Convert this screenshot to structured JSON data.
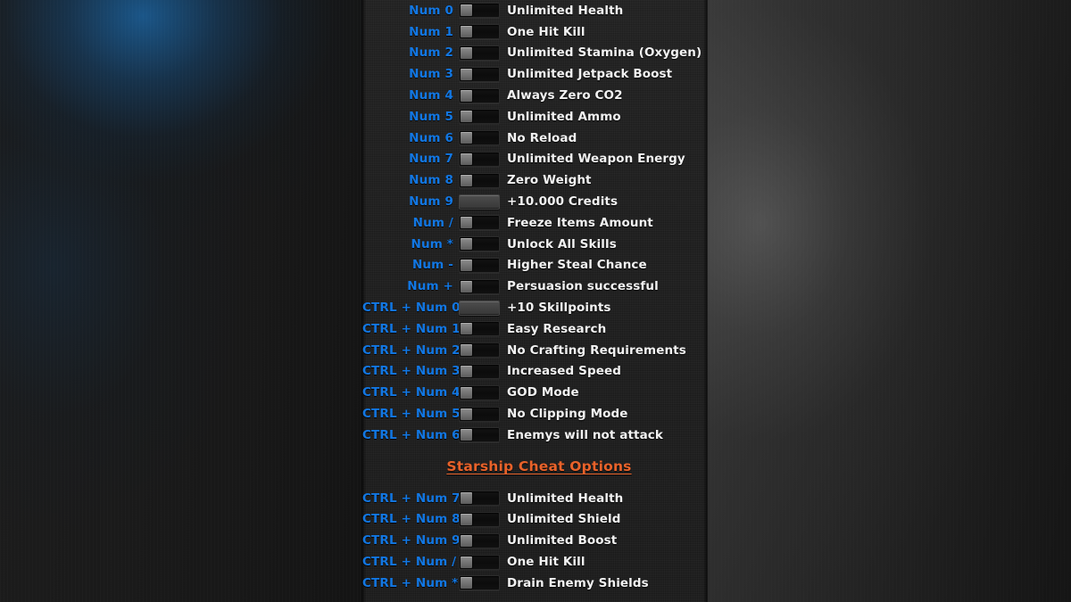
{
  "panel": {
    "accent_hotkey_color": "#1277e3",
    "accent_label_color": "#f2f2f2",
    "accent_section_color": "#e8622a",
    "panel_bg_color": "#1b1b1b",
    "toggle_state": "off"
  },
  "sections": [
    {
      "title": null,
      "rows": [
        {
          "hotkey": "Num 0",
          "control": "toggle",
          "label": "Unlimited Health"
        },
        {
          "hotkey": "Num 1",
          "control": "toggle",
          "label": "One Hit Kill"
        },
        {
          "hotkey": "Num 2",
          "control": "toggle",
          "label": "Unlimited Stamina (Oxygen)"
        },
        {
          "hotkey": "Num 3",
          "control": "toggle",
          "label": "Unlimited Jetpack Boost"
        },
        {
          "hotkey": "Num 4",
          "control": "toggle",
          "label": "Always Zero CO2"
        },
        {
          "hotkey": "Num 5",
          "control": "toggle",
          "label": "Unlimited Ammo"
        },
        {
          "hotkey": "Num 6",
          "control": "toggle",
          "label": "No Reload"
        },
        {
          "hotkey": "Num 7",
          "control": "toggle",
          "label": "Unlimited Weapon Energy"
        },
        {
          "hotkey": "Num 8",
          "control": "toggle",
          "label": "Zero Weight"
        },
        {
          "hotkey": "Num 9",
          "control": "button",
          "label": "+10.000 Credits"
        },
        {
          "hotkey": "Num /",
          "control": "toggle",
          "label": "Freeze Items Amount"
        },
        {
          "hotkey": "Num *",
          "control": "toggle",
          "label": "Unlock All Skills"
        },
        {
          "hotkey": "Num -",
          "control": "toggle",
          "label": "Higher Steal Chance"
        },
        {
          "hotkey": "Num +",
          "control": "toggle",
          "label": "Persuasion successful"
        },
        {
          "hotkey": "CTRL + Num 0",
          "control": "button",
          "label": "+10 Skillpoints"
        },
        {
          "hotkey": "CTRL + Num 1",
          "control": "toggle",
          "label": "Easy Research"
        },
        {
          "hotkey": "CTRL + Num 2",
          "control": "toggle",
          "label": "No Crafting Requirements"
        },
        {
          "hotkey": "CTRL + Num 3",
          "control": "toggle",
          "label": "Increased Speed"
        },
        {
          "hotkey": "CTRL + Num 4",
          "control": "toggle",
          "label": "GOD Mode"
        },
        {
          "hotkey": "CTRL + Num 5",
          "control": "toggle",
          "label": "No Clipping Mode"
        },
        {
          "hotkey": "CTRL + Num 6",
          "control": "toggle",
          "label": "Enemys will not attack"
        }
      ]
    },
    {
      "title": "Starship Cheat Options",
      "rows": [
        {
          "hotkey": "CTRL + Num 7",
          "control": "toggle",
          "label": "Unlimited Health"
        },
        {
          "hotkey": "CTRL + Num 8",
          "control": "toggle",
          "label": "Unlimited Shield"
        },
        {
          "hotkey": "CTRL + Num 9",
          "control": "toggle",
          "label": "Unlimited Boost"
        },
        {
          "hotkey": "CTRL + Num /",
          "control": "toggle",
          "label": "One Hit Kill"
        },
        {
          "hotkey": "CTRL + Num *",
          "control": "toggle",
          "label": "Drain Enemy Shields"
        }
      ]
    }
  ]
}
